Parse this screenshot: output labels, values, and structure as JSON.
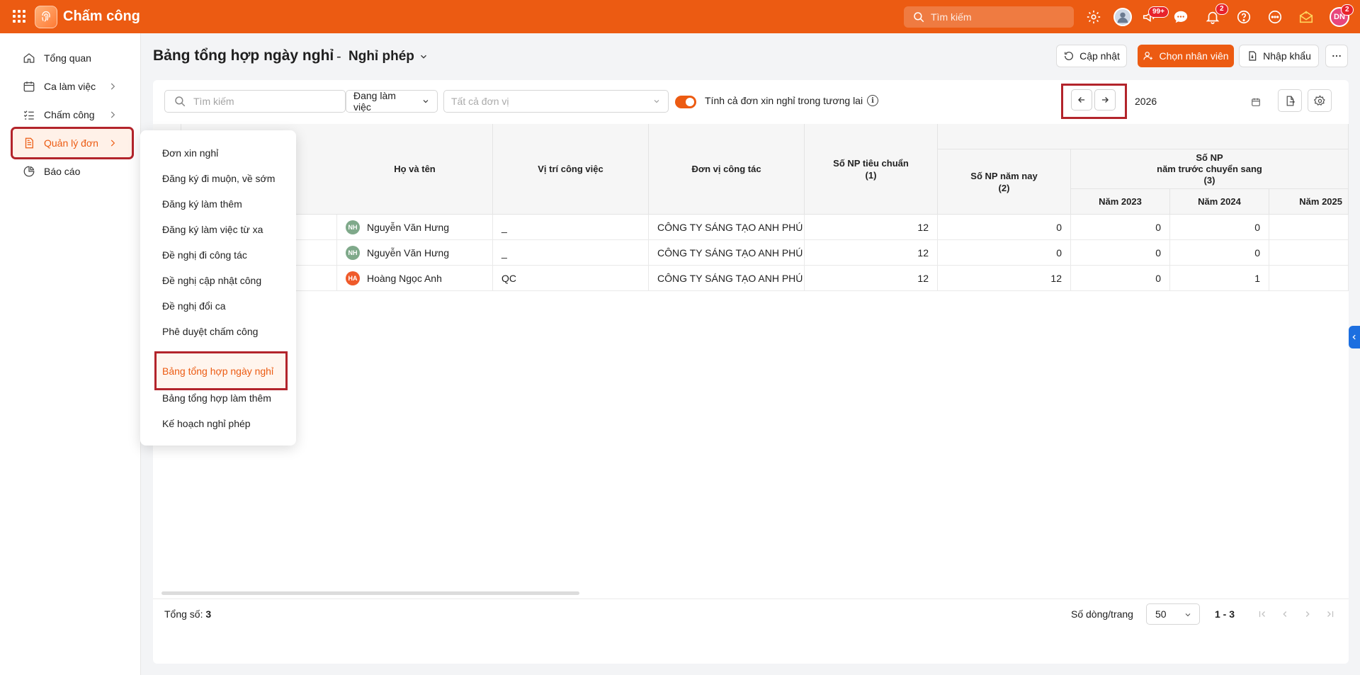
{
  "app": {
    "title": "Chấm công",
    "search_placeholder": "Tìm kiếm"
  },
  "topbar": {
    "badge_99": "99+",
    "badge_notif": "2",
    "avatar_initials": "DN",
    "avatar_badge": "2"
  },
  "sidebar": {
    "items": [
      {
        "label": "Tổng quan",
        "icon": "home-icon"
      },
      {
        "label": "Ca làm việc",
        "icon": "calendar-icon"
      },
      {
        "label": "Chấm công",
        "icon": "checklist-icon"
      },
      {
        "label": "Quản lý đơn",
        "icon": "document-icon"
      },
      {
        "label": "Báo cáo",
        "icon": "pie-chart-icon"
      }
    ],
    "collapse_glyph": "⇤"
  },
  "header": {
    "title": "Bảng tổng hợp ngày nghỉ",
    "dash": "-",
    "subtitle": "Nghỉ phép",
    "btn_refresh": "Cập nhật",
    "btn_choose": "Chọn nhân viên",
    "btn_import": "Nhập khẩu"
  },
  "filters": {
    "search_placeholder": "Tìm kiếm",
    "status": "Đang làm việc",
    "unit_placeholder": "Tất cả đơn vị",
    "toggle_label": "Tính cả đơn xin nghỉ trong tương lai",
    "toggle_on": true,
    "year": "2026"
  },
  "table": {
    "headers": {
      "name": "Họ và tên",
      "position": "Vị trí công việc",
      "unit": "Đơn vị công tác",
      "std": "Số NP tiêu chuẩn",
      "std_n": "(1)",
      "cur": "Số NP năm nay",
      "cur_n": "(2)",
      "prev": "Số NP",
      "prev2": "năm trước chuyển sang",
      "prev_n": "(3)",
      "y2023": "Năm 2023",
      "y2024": "Năm 2024",
      "y2025": "Năm 2025"
    },
    "rows": [
      {
        "initials": "NH",
        "avatar_color": "#7fa98a",
        "name": "Nguyễn Văn Hưng",
        "position": "_",
        "unit": "CÔNG TY SÁNG TẠO ANH PHÚ",
        "std": "12",
        "cur": "0",
        "y2023": "0",
        "y2024": "0"
      },
      {
        "initials": "NH",
        "avatar_color": "#7fa98a",
        "name": "Nguyễn Văn Hưng",
        "position": "_",
        "unit": "CÔNG TY SÁNG TẠO ANH PHÚ",
        "std": "12",
        "cur": "0",
        "y2023": "0",
        "y2024": "0"
      },
      {
        "initials": "HA",
        "avatar_color": "#ef5a2a",
        "name": "Hoàng Ngọc Anh",
        "position": "QC",
        "unit": "CÔNG TY SÁNG TẠO ANH PHÚ",
        "std": "12",
        "cur": "12",
        "y2023": "0",
        "y2024": "1"
      }
    ]
  },
  "footer": {
    "total_label": "Tổng số:",
    "total_value": "3",
    "rows_per_page_label": "Số dòng/trang",
    "rows_per_page": "50",
    "range": "1 - 3"
  },
  "dropdown": {
    "items": [
      "Đơn xin nghỉ",
      "Đăng ký đi muộn, về sớm",
      "Đăng ký làm thêm",
      "Đăng ký làm việc từ xa",
      "Đề nghị đi công tác",
      "Đề nghị cập nhật công",
      "Đề nghị đổi ca",
      "Phê duyệt chấm công",
      "Bảng tổng hợp ngày nghỉ",
      "Bảng tổng hợp làm thêm",
      "Kế hoạch nghỉ phép"
    ]
  },
  "colors": {
    "brand": "#ec5b12",
    "highlight": "#b3242b"
  }
}
